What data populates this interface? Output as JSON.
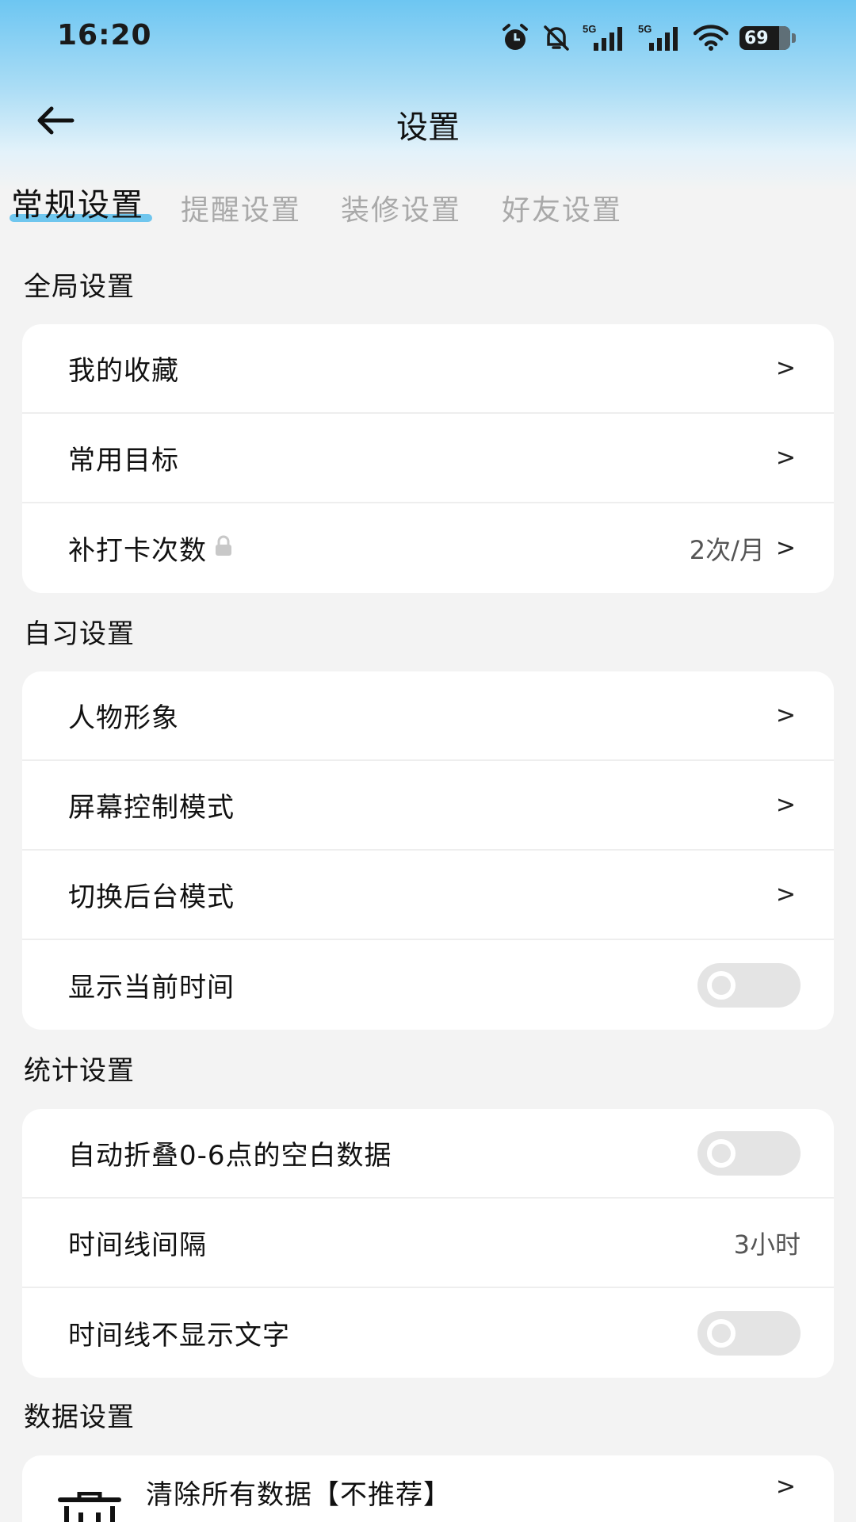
{
  "status_bar": {
    "time": "16:20",
    "battery": "69",
    "icons": [
      "alarm-icon",
      "mute-bell-icon",
      "signal-5g-icon",
      "signal-5g-icon",
      "wifi-icon",
      "battery-icon"
    ]
  },
  "nav": {
    "title": "设置",
    "back_icon": "arrow-left-icon"
  },
  "tabs": [
    {
      "label": "常规设置",
      "active": true
    },
    {
      "label": "提醒设置",
      "active": false
    },
    {
      "label": "装修设置",
      "active": false
    },
    {
      "label": "好友设置",
      "active": false
    }
  ],
  "sections": {
    "global": {
      "title": "全局设置",
      "items": [
        {
          "label": "我的收藏",
          "value": "",
          "control": "chevron"
        },
        {
          "label": "常用目标",
          "value": "",
          "control": "chevron"
        },
        {
          "label": "补打卡次数",
          "value": "2次/月",
          "control": "chevron",
          "locked": true
        }
      ]
    },
    "study": {
      "title": "自习设置",
      "items": [
        {
          "label": "人物形象",
          "control": "chevron"
        },
        {
          "label": "屏幕控制模式",
          "control": "chevron"
        },
        {
          "label": "切换后台模式",
          "control": "chevron"
        },
        {
          "label": "显示当前时间",
          "control": "toggle",
          "on": false
        }
      ]
    },
    "stats": {
      "title": "统计设置",
      "items": [
        {
          "label": "自动折叠0-6点的空白数据",
          "control": "toggle",
          "on": false
        },
        {
          "label": "时间线间隔",
          "value": "3小时",
          "control": "value"
        },
        {
          "label": "时间线不显示文字",
          "control": "toggle",
          "on": false
        }
      ]
    },
    "data": {
      "title": "数据设置",
      "items": [
        {
          "label": "清除所有数据【不推荐】",
          "control": "chevron",
          "icon": "trash-icon"
        }
      ]
    }
  },
  "chevron_glyph": ">",
  "colors": {
    "accent_underline": "#6fc6ee",
    "header_top": "#6dc6f2",
    "page_bg": "#f3f3f3",
    "toggle_off": "#e4e4e4",
    "inactive_tab": "#a9a9a9"
  }
}
